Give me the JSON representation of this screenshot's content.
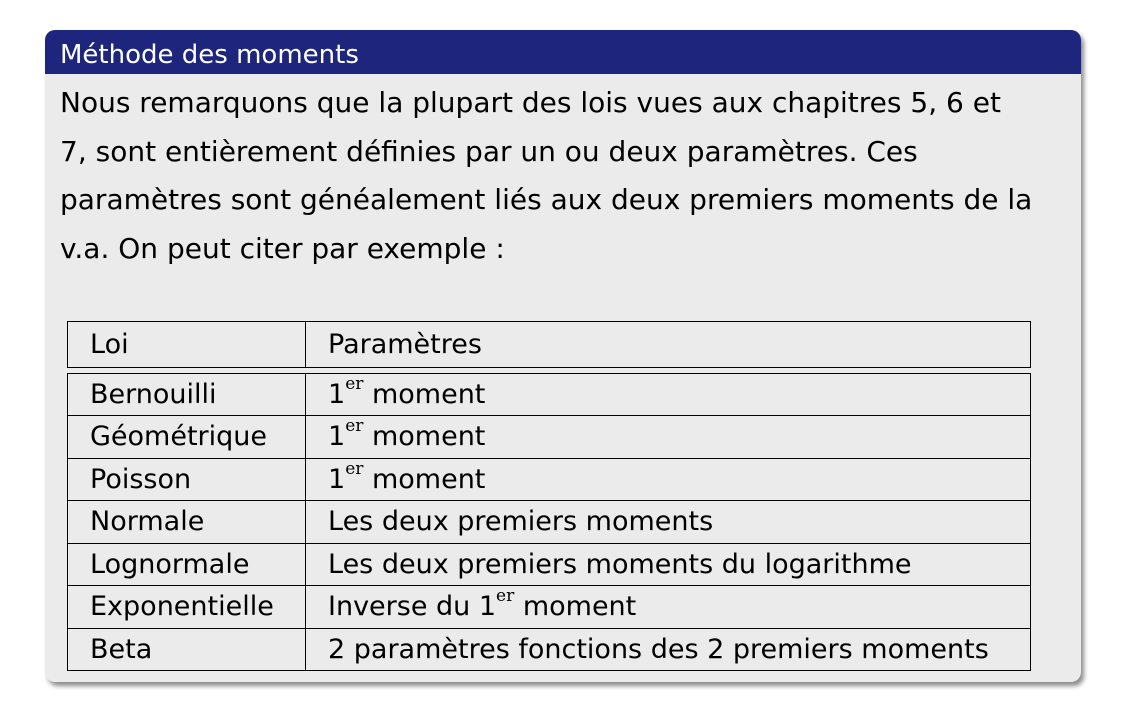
{
  "block": {
    "title": "Méthode des moments",
    "paragraph": [
      "Nous remarquons que la plupart des lois vues aux chapitres 5, 6 et",
      "7, sont entièrement définies par un ou deux paramètres. Ces",
      "paramètres sont généalement liés aux deux premiers moments de la",
      "v.a. On peut citer par exemple :"
    ]
  },
  "table": {
    "headers": [
      "Loi",
      "Paramètres"
    ],
    "rows": [
      {
        "loi": "Bernouilli",
        "pre": "1",
        "sup": "er",
        "post": " moment"
      },
      {
        "loi": "Géométrique",
        "pre": "1",
        "sup": "er",
        "post": " moment"
      },
      {
        "loi": "Poisson",
        "pre": "1",
        "sup": "er",
        "post": " moment"
      },
      {
        "loi": "Normale",
        "pre": "Les deux premiers moments",
        "sup": "",
        "post": ""
      },
      {
        "loi": "Lognormale",
        "pre": "Les deux premiers moments du logarithme",
        "sup": "",
        "post": ""
      },
      {
        "loi": "Exponentielle",
        "pre": "Inverse du 1",
        "sup": "er",
        "post": " moment"
      },
      {
        "loi": "Beta",
        "pre": "2 paramètres fonctions des 2 premiers moments",
        "sup": "",
        "post": ""
      }
    ]
  }
}
